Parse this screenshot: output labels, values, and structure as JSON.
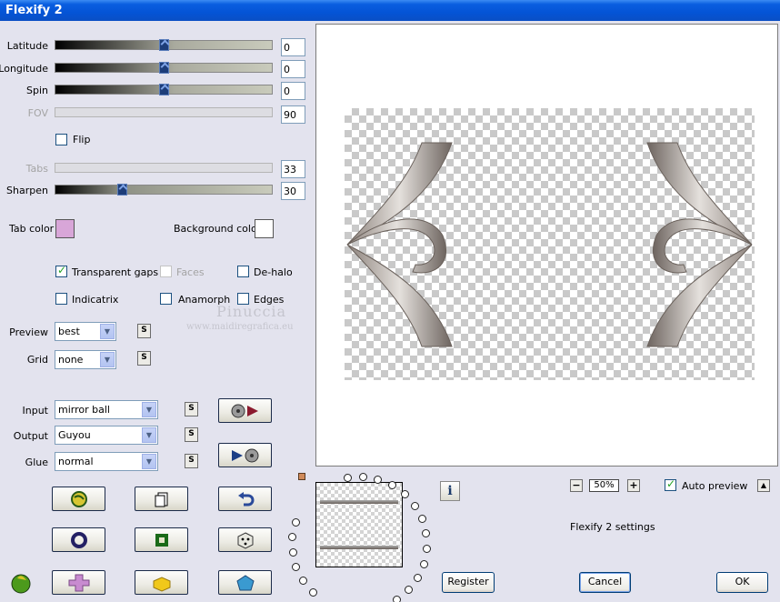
{
  "window": {
    "title": "Flexify 2"
  },
  "params": {
    "latitude": {
      "label": "Latitude",
      "value": "0",
      "position": 0.5
    },
    "longitude": {
      "label": "Longitude",
      "value": "0",
      "position": 0.5
    },
    "spin": {
      "label": "Spin",
      "value": "0",
      "position": 0.5
    },
    "fov": {
      "label": "FOV",
      "value": "90"
    },
    "flip": {
      "label": "Flip",
      "checked": false
    },
    "tabs": {
      "label": "Tabs",
      "value": "33"
    },
    "sharpen": {
      "label": "Sharpen",
      "value": "30",
      "position": 0.3
    }
  },
  "colors": {
    "tab_color_label": "Tab color",
    "tab_color": "#d8a6d8",
    "background_color_label": "Background color",
    "background_color": "#ffffff"
  },
  "options": {
    "transparent_gaps": {
      "label": "Transparent gaps",
      "checked": true
    },
    "faces": {
      "label": "Faces",
      "checked": false
    },
    "de_halo": {
      "label": "De-halo",
      "checked": false
    },
    "indicatrix": {
      "label": "Indicatrix",
      "checked": false
    },
    "anamorph": {
      "label": "Anamorph",
      "checked": false
    },
    "edges": {
      "label": "Edges",
      "checked": false
    }
  },
  "selects": {
    "preview": {
      "label": "Preview",
      "value": "best"
    },
    "grid": {
      "label": "Grid",
      "value": "none"
    },
    "input": {
      "label": "Input",
      "value": "mirror ball"
    },
    "output": {
      "label": "Output",
      "value": "Guyou"
    },
    "glue": {
      "label": "Glue",
      "value": "normal"
    }
  },
  "watermark": {
    "name": "Pinuccia",
    "url": "www.maidiregrafica.eu"
  },
  "zoom": {
    "value": "50%"
  },
  "auto_preview": {
    "label": "Auto preview",
    "checked": true
  },
  "settings_label": "Flexify 2 settings",
  "buttons": {
    "register": "Register",
    "cancel": "Cancel",
    "ok": "OK",
    "s": "S"
  }
}
